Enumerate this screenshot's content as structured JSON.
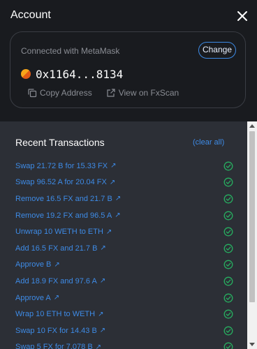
{
  "header": {
    "title": "Account"
  },
  "account": {
    "connected_label": "Connected with MetaMask",
    "change_label": "Change",
    "address": "0x1164...8134",
    "copy_label": "Copy Address",
    "view_label": "View on FxScan"
  },
  "recent": {
    "title": "Recent Transactions",
    "clear_label": "(clear all)",
    "transactions": [
      {
        "label": "Swap 21.72 B for 15.33 FX",
        "status": "confirmed"
      },
      {
        "label": "Swap 96.52 A for 20.04 FX",
        "status": "confirmed"
      },
      {
        "label": "Remove 16.5 FX and 21.7 B",
        "status": "confirmed"
      },
      {
        "label": "Remove 19.2 FX and 96.5 A",
        "status": "confirmed"
      },
      {
        "label": "Unwrap 10 WETH to ETH",
        "status": "confirmed"
      },
      {
        "label": "Add 16.5 FX and 21.7 B",
        "status": "confirmed"
      },
      {
        "label": "Approve B",
        "status": "confirmed"
      },
      {
        "label": "Add 18.9 FX and 97.6 A",
        "status": "confirmed"
      },
      {
        "label": "Approve A",
        "status": "confirmed"
      },
      {
        "label": "Wrap 10 ETH to WETH",
        "status": "confirmed"
      },
      {
        "label": "Swap 10 FX for 14.43 B",
        "status": "confirmed"
      },
      {
        "label": "Swap 5 FX for 7.078 B",
        "status": "confirmed"
      }
    ]
  },
  "colors": {
    "accent": "#3e8be6",
    "success": "#27ae60",
    "background": "#191b1f",
    "panel": "#2c2f36"
  },
  "icons": {
    "close": "close-icon",
    "copy": "copy-icon",
    "external": "external-link-icon",
    "check": "check-circle-icon",
    "avatar": "wallet-avatar-icon"
  }
}
